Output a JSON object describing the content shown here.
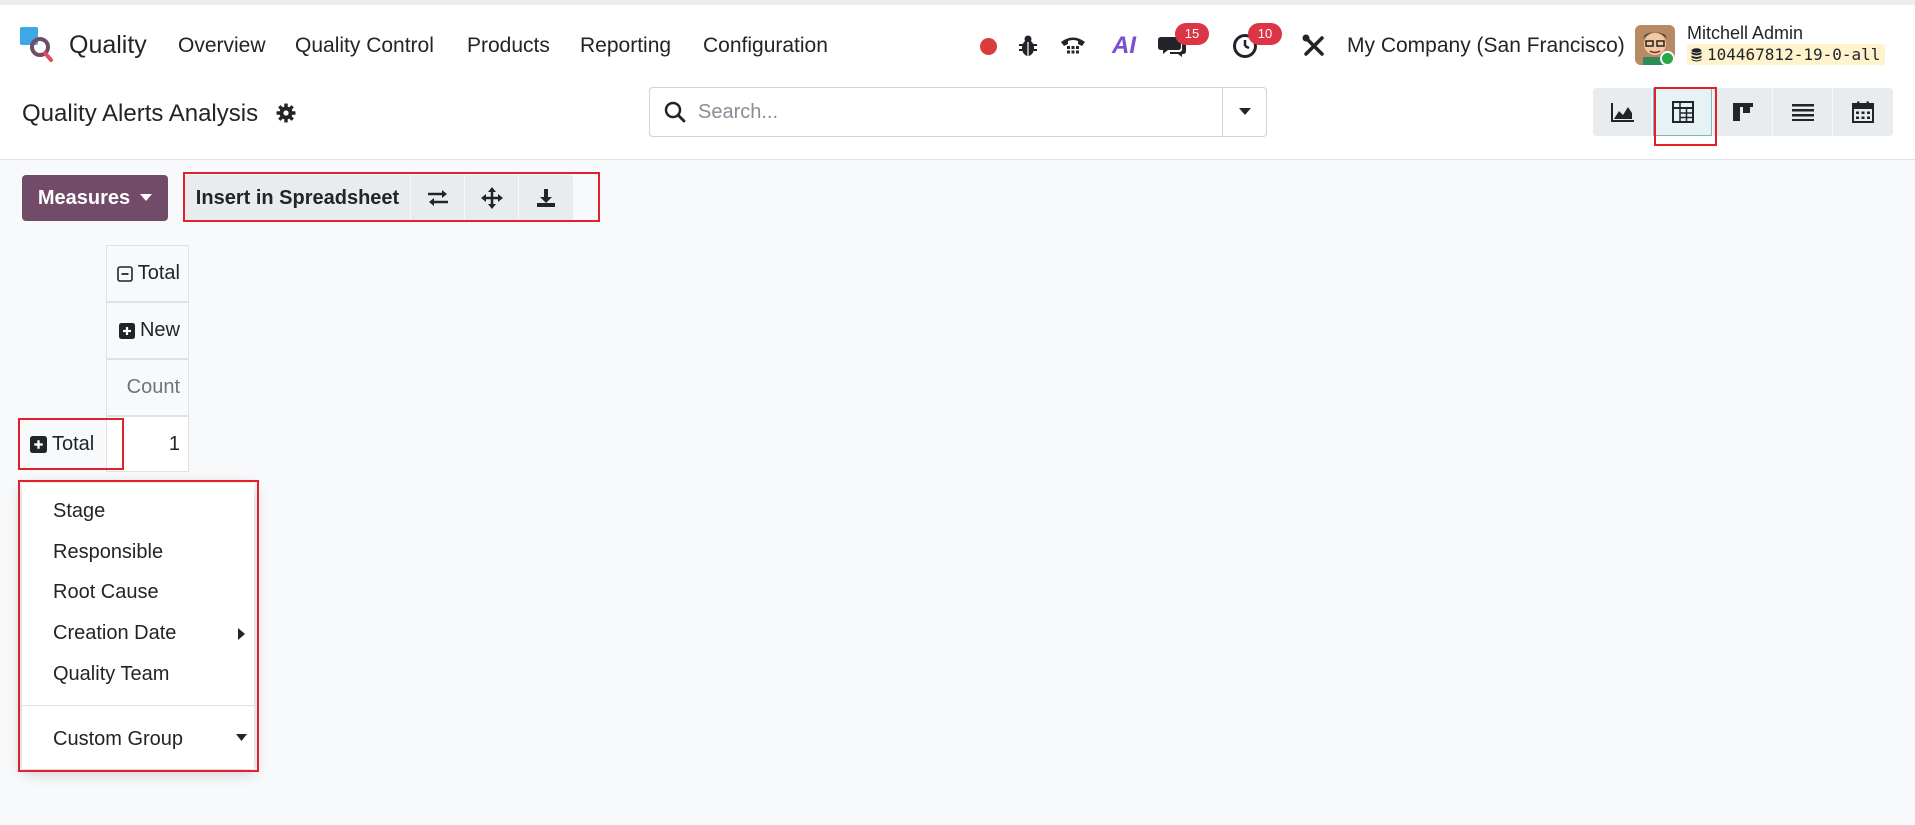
{
  "navbar": {
    "app_name": "Quality",
    "menu": [
      "Overview",
      "Quality Control",
      "Products",
      "Reporting",
      "Configuration"
    ],
    "chat_badge": "15",
    "activity_badge": "10",
    "ai_label": "AI",
    "company": "My Company (San Francisco)",
    "user_name": "Mitchell Admin",
    "database": "104467812-19-0-all"
  },
  "control_panel": {
    "title": "Quality Alerts Analysis",
    "search_placeholder": "Search...",
    "views": [
      "graph-view",
      "pivot-view",
      "kanban-view",
      "list-view",
      "calendar-view"
    ],
    "active_view": "pivot-view"
  },
  "toolbar": {
    "measures_label": "Measures",
    "insert_label": "Insert in Spreadsheet"
  },
  "pivot": {
    "col_header_total": "Total",
    "col_header_new": "New",
    "measure_label": "Count",
    "row_header": "Total",
    "value": "1"
  },
  "groupby_menu": {
    "items": [
      "Stage",
      "Responsible",
      "Root Cause",
      "Creation Date",
      "Quality Team"
    ],
    "custom_group": "Custom Group"
  },
  "colors": {
    "primary": "#714b67",
    "badge": "#dc3545",
    "highlight": "#e0202a",
    "record_dot": "#d93c3c",
    "online": "#28a745"
  }
}
